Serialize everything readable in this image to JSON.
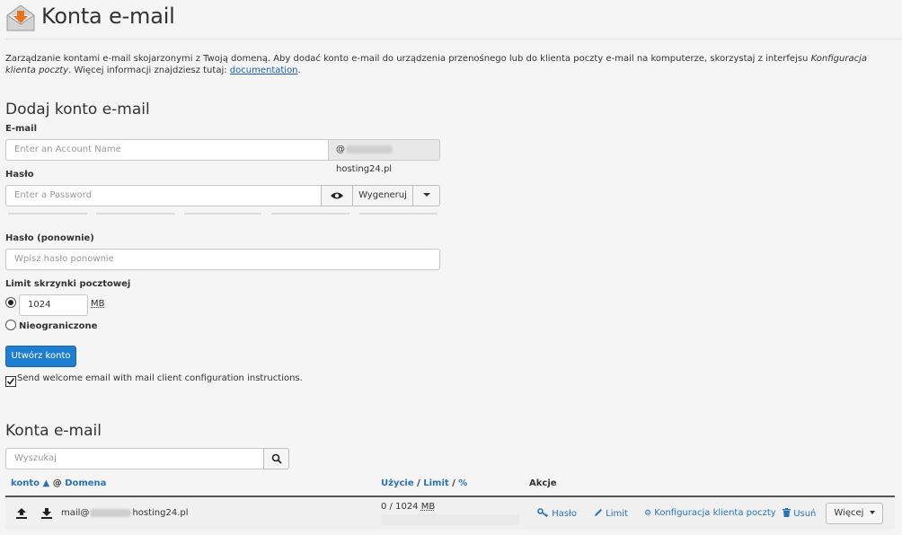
{
  "header": {
    "title": "Konta e-mail",
    "icon": "email-envelope-download-icon"
  },
  "description": {
    "text_before": "Zarządzanie kontami e-mail skojarzonymi z Twoją domeną. Aby dodać konto e-mail do urządzenia przenośnego lub do klienta poczty e-mail na komputerze, skorzystaj z interfejsu ",
    "italic": "Konfiguracja klienta poczty",
    "text_after": ". Więcej informacji znajdziesz tutaj: ",
    "link": "documentation",
    "end": "."
  },
  "add_account": {
    "title": "Dodaj konto e-mail",
    "email_label": "E-mail",
    "email_placeholder": "Enter an Account Name",
    "domain_at": "@",
    "domain_suffix": "hosting24.pl",
    "password_label": "Hasło",
    "password_placeholder": "Enter a Password",
    "generate_label": "Wygeneruj",
    "password2_label": "Hasło (ponownie)",
    "password2_placeholder": "Wpisz hasło ponownie",
    "quota_label": "Limit skrzynki pocztowej",
    "quota_value": "1024",
    "quota_unit": "MB",
    "unlimited_label": "Nieograniczone",
    "create_button": "Utwórz konto",
    "welcome_label": "Send welcome email with mail client configuration instructions."
  },
  "accounts": {
    "title": "Konta e-mail",
    "search_placeholder": "Wyszukaj",
    "col_account": "konto",
    "col_sort": "▲",
    "col_at_domain": "@",
    "col_domain": "Domena",
    "col_usage": "Użycie",
    "col_sep1": "/",
    "col_limit": "Limit",
    "col_sep2": "/",
    "col_percent": "%",
    "col_actions": "Akcje",
    "rows": [
      {
        "email_prefix": "mail@",
        "email_suffix": "hosting24.pl",
        "usage": "0 / 1024",
        "usage_unit": "MB",
        "usage_fraction": 0,
        "action_password": "Hasło",
        "action_limit": "Limit",
        "action_config": "Konfiguracja klienta poczty",
        "action_delete": "Usuń",
        "action_more": "Więcej"
      }
    ]
  },
  "colors": {
    "accent": "#1e7fd1",
    "link": "#2a73b8",
    "icon_orange": "#e8731f"
  }
}
